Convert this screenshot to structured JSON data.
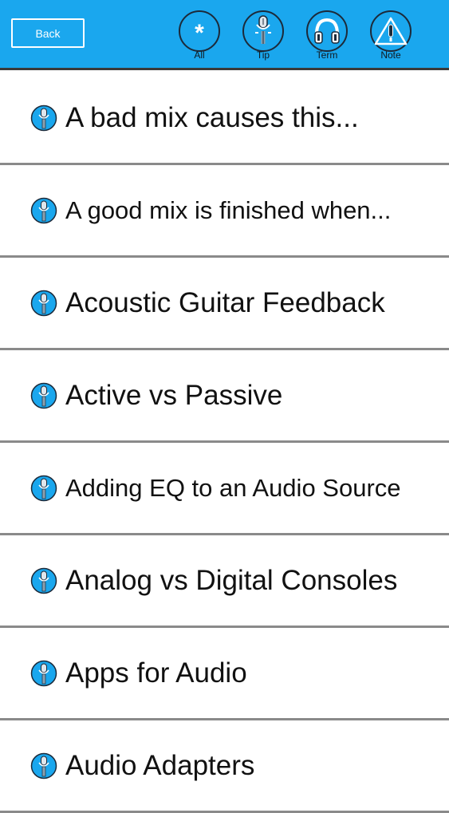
{
  "header": {
    "back_label": "Back",
    "filters": [
      {
        "label": "All",
        "icon": "asterisk-icon"
      },
      {
        "label": "Tip",
        "icon": "microphone-icon"
      },
      {
        "label": "Term",
        "icon": "headphones-icon"
      },
      {
        "label": "Note",
        "icon": "warning-microphone-icon"
      }
    ],
    "colors": {
      "header_bg": "#1aa7ee",
      "divider": "#8a8a8a"
    }
  },
  "list": {
    "item_icon": "microphone-tip-icon",
    "items": [
      {
        "label": "A bad mix causes this..."
      },
      {
        "label": "A good mix is finished when..."
      },
      {
        "label": "Acoustic Guitar Feedback"
      },
      {
        "label": "Active vs Passive"
      },
      {
        "label": "Adding EQ to an Audio Source"
      },
      {
        "label": "Analog vs Digital Consoles"
      },
      {
        "label": "Apps for Audio"
      },
      {
        "label": "Audio Adapters"
      }
    ]
  }
}
